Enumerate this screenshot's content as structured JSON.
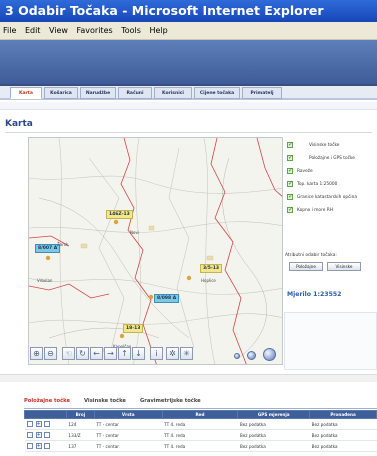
{
  "window": {
    "title": "Odabir Točaka - Microsoft Internet Explorer",
    "title_prefix": "3"
  },
  "menu": [
    "File",
    "Edit",
    "View",
    "Favorites",
    "Tools",
    "Help"
  ],
  "tabs": [
    "Karta",
    "Košarica",
    "Narudžbe",
    "Računi",
    "Korisnici",
    "Cijene točaka",
    "Primatelj"
  ],
  "page": {
    "heading": "Karta"
  },
  "map": {
    "labels": [
      {
        "text": "146Z-13",
        "style": "yellow"
      },
      {
        "text": "8/007 A",
        "style": "cyan"
      },
      {
        "text": "3/5-13",
        "style": "yellow"
      },
      {
        "text": "8/098 A",
        "style": "cyan"
      },
      {
        "text": "18-13",
        "style": "yellow"
      }
    ],
    "places": [
      "Žarsk",
      "Novi",
      "Hoplice",
      "Vrbolan",
      "Kapelčan"
    ]
  },
  "layers": [
    {
      "label": "Visinske točke",
      "checked": true
    },
    {
      "label": "Položajne i GPS točke",
      "checked": true
    },
    {
      "label": "Raveže",
      "checked": true
    },
    {
      "label": "Top. karta 1:25000",
      "checked": true
    },
    {
      "label": "Granice katastarskih općina",
      "checked": true
    },
    {
      "label": "Kopno i more RH",
      "checked": true
    }
  ],
  "attributes": {
    "label": "Atributni odabir točaka:",
    "buttons": [
      "Položajne",
      "Visinske"
    ]
  },
  "scale": {
    "text": "Mjerilo 1:23552"
  },
  "bottom_tabs": [
    "Položajne točke",
    "Visinske točke",
    "Gravimetrijske točke"
  ],
  "table": {
    "headers": [
      "",
      "Broj",
      "Vrsta",
      "Red",
      "GPS mjerenja",
      "Pronađena"
    ],
    "rows": [
      [
        "",
        "124",
        "TT - centar",
        "TT 4. reda",
        "Bez podatka",
        "Bez podatka"
      ],
      [
        "",
        "133/Z",
        "TT - centar",
        "TT 4. reda",
        "Bez podatka",
        "Bez podatka"
      ],
      [
        "",
        "137",
        "TT - centar",
        "TT 4. reda",
        "Bez podatka",
        "Bez podatka"
      ]
    ]
  },
  "colors": {
    "accent_red": "#c62d1f",
    "header_blue": "#3f5f9a",
    "title_blue": "#1746b8"
  }
}
